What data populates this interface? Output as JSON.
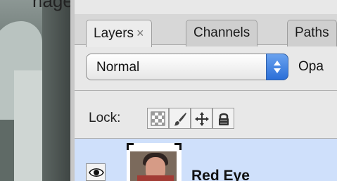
{
  "window": {
    "background_caption": "nage is Uiu Jeci ue 'sp ay"
  },
  "tabs": [
    {
      "label": "Layers",
      "close": "×",
      "active": true
    },
    {
      "label": "Channels",
      "active": false
    },
    {
      "label": "Paths",
      "active": false
    }
  ],
  "blend_mode": {
    "value": "Normal"
  },
  "opacity": {
    "label": "Opa"
  },
  "lock": {
    "label": "Lock:",
    "icons": [
      "transparency-lock-icon",
      "brush-lock-icon",
      "move-lock-icon",
      "padlock-icon"
    ]
  },
  "layers": [
    {
      "name": "Red Eye",
      "visible": true,
      "selected": true
    }
  ],
  "colors": {
    "selection": "#cfe0fb",
    "stepper_accent": "#2b6fd8"
  }
}
